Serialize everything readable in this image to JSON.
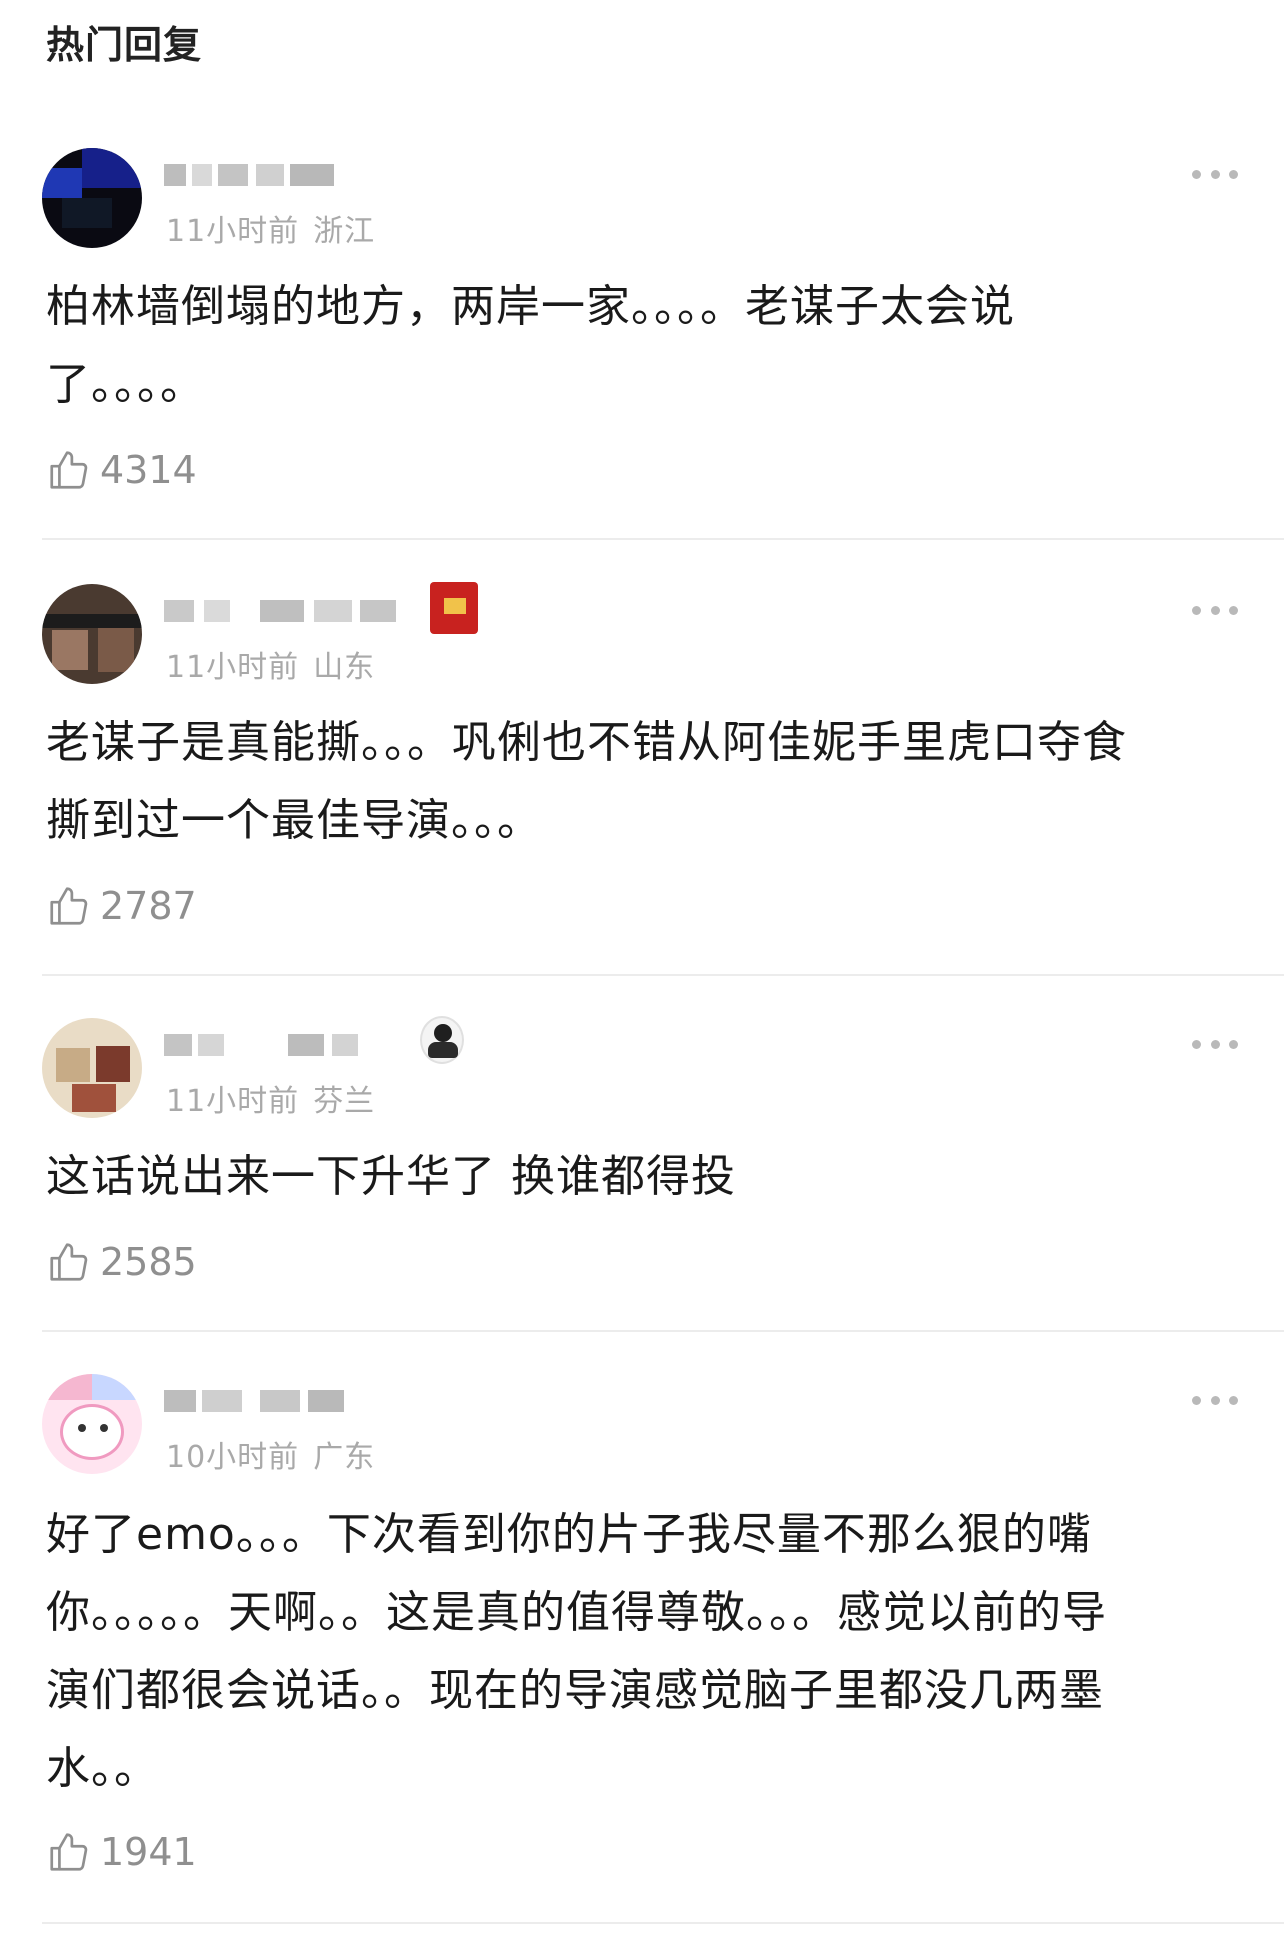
{
  "section": {
    "title": "热门回复"
  },
  "comments": [
    {
      "time": "11小时前",
      "location": "浙江",
      "text": "柏林墙倒塌的地方，两岸一家。。。。老谋子太会说\n了。。。。",
      "likes": "4314",
      "avatar_colors": [
        "#0b1f78",
        "#0a0a0f",
        "#233cae"
      ]
    },
    {
      "time": "11小时前",
      "location": "山东",
      "text": "老谋子是真能撕。。。巩俐也不错从阿佳妮手里虎口夺食\n撕到过一个最佳导演。。。",
      "likes": "2787",
      "avatar_colors": [
        "#3a2a22",
        "#8a6a55",
        "#1e1e1e"
      ]
    },
    {
      "time": "11小时前",
      "location": "芬兰",
      "text": "这话说出来一下升华了 换谁都得投",
      "likes": "2585",
      "avatar_colors": [
        "#d8c6a6",
        "#8b3d2f",
        "#f1e7d6"
      ]
    },
    {
      "time": "10小时前",
      "location": "广东",
      "text": "好了emo。。。下次看到你的片子我尽量不那么狠的嘴\n你。。。。。天啊。。这是真的值得尊敬。。。感觉以前的导\n演们都很会说话。。现在的导演感觉脑子里都没几两墨\n水。。",
      "likes": "1941",
      "avatar_colors": [
        "#f4a7c8",
        "#ffffff",
        "#bcd3ff"
      ]
    }
  ],
  "icons": {
    "like": "thumbs-up-icon",
    "more": "more-dots-icon"
  },
  "colors": {
    "meta": "#a9a9a9",
    "like": "#8f8f8f",
    "divider": "#ececec"
  }
}
